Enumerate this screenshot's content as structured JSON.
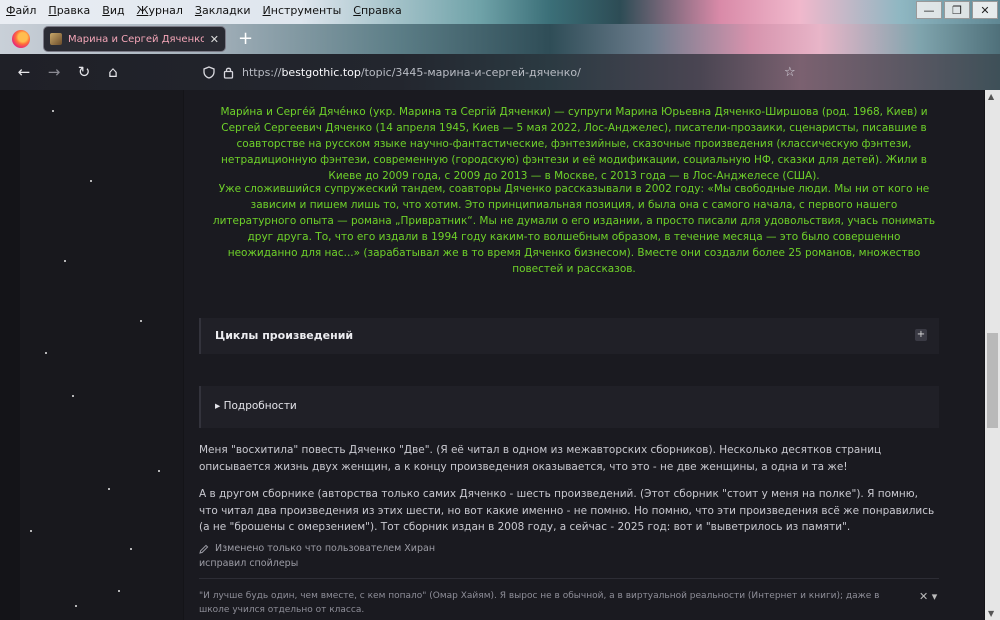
{
  "menu": [
    "Файл",
    "Правка",
    "Вид",
    "Журнал",
    "Закладки",
    "Инструменты",
    "Справка"
  ],
  "window_controls": {
    "minimize": "—",
    "maximize": "❐",
    "close": "✕"
  },
  "tab": {
    "title": "Марина и Сергей Дяченко - Л",
    "close": "✕",
    "new_tab": "+"
  },
  "nav": {
    "back": "←",
    "forward": "→",
    "reload": "↻",
    "home": "⌂"
  },
  "address": {
    "host": "bestgothic.top",
    "prefix": "https://",
    "path": "/topic/3445-марина-и-сергей-дяченко/",
    "shield_icon": "shield-icon",
    "lock_icon": "lock-icon",
    "star": "☆"
  },
  "bio": {
    "paragraph1": "Мари́на и Серге́й Дячéнко (укр. Марина та Сергій Дяченки) — супруги Марина Юрьевна Дяченко-Ширшова (род. 1968, Киев) и Сергей Сергеевич Дяченко (14 апреля 1945, Киев — 5 мая 2022, Лос-Анджелес), писатели-прозаики, сценаристы, писавшие в соавторстве на русском языке научно-фантастические, фэнтезийные, сказочные произведения (классическую фэнтези, нетрадиционную фэнтези, современную (городскую) фэнтези и её модификации, социальную НФ, сказки для детей). Жили в Киеве до 2009 года, с 2009 до 2013 — в Москве, с 2013 года — в Лос-Анджелесе (США).",
    "paragraph2": "Уже сложившийся супружеский тандем, соавторы Дяченко рассказывали в 2002 году: «Мы свободные люди. Мы ни от кого не зависим и пишем лишь то, что хотим. Это принципиальная позиция, и была она с самого начала, с первого нашего литературного опыта — романа „Привратник“. Мы не думали о его издании, а просто писали для удовольствия, учась понимать друг друга. То, что его издали в 1994 году каким-то волшебным образом, в течение месяца — это было совершенно неожиданно для нас...» (зарабатывал же в то время Дяченко бизнесом). Вместе они создали более 25 романов, множество повестей и рассказов."
  },
  "spoilers": {
    "cycles": "Циклы произведений",
    "cycles_toggle": "+",
    "details": "▸ Подробности"
  },
  "post": {
    "paragraph1": "Меня \"восхитила\" повесть Дяченко \"Две\". (Я её читал в одном из межавторских сборников). Несколько десятков страниц описывается жизнь двух женщин, а к концу произведения оказывается, что это - не две женщины, а одна и та же!",
    "paragraph2": "А в другом сборнике (авторства только самих Дяченко - шесть произведений. (Этот сборник \"стоит у меня на полке\"). Я помню, что читал два произведения из этих шести, но вот какие именно - не помню. Но помню, что эти произведения всё же понравились (а не \"брошены с омерзением\"). Тот сборник издан в 2008 году, а сейчас - 2025 год: вот и \"выветрилось из памяти\".",
    "edited": "Изменено только что пользователем Хиран",
    "edit_reason": "исправил спойлеры",
    "signature": "\"И лучше будь один, чем вместе, с кем попало\" (Омар Хайям). Я вырос не в обычной, а в виртуальной реальности (Интернет и книги); даже в школе учился отдельно от класса.",
    "signature_controls": "✕ ▾"
  },
  "colors": {
    "green_text": "#6fd22a",
    "tab_title": "#f4a6b8"
  }
}
